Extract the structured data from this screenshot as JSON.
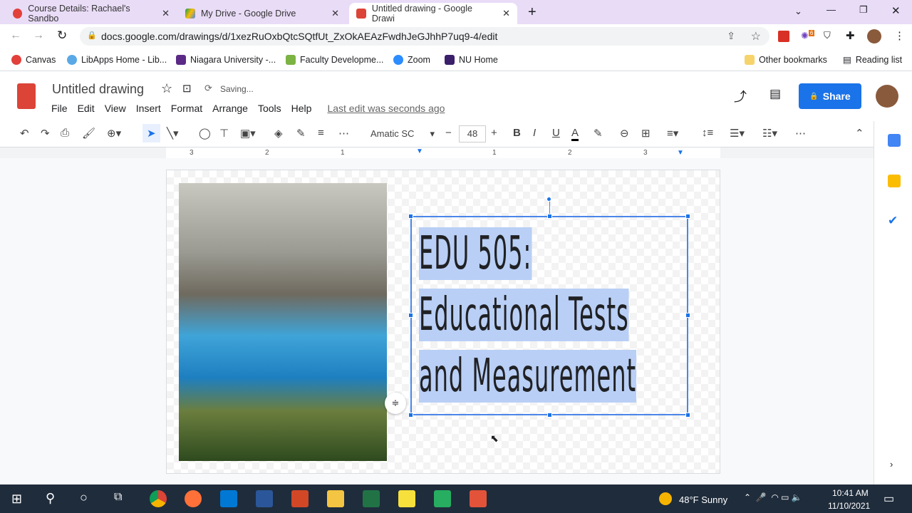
{
  "browser": {
    "tabs": [
      {
        "title": "Course Details: Rachael's Sandbo"
      },
      {
        "title": "My Drive - Google Drive"
      },
      {
        "title": "Untitled drawing - Google Drawi",
        "active": true
      }
    ],
    "url": "docs.google.com/drawings/d/1xezRuOxbQtcSQtfUt_ZxOkAEAzFwdhJeGJhhP7uq9-4/edit",
    "bookmarks": [
      "Canvas",
      "LibApps Home - Lib...",
      "Niagara University -...",
      "Faculty Developme...",
      "Zoom",
      "NU Home"
    ],
    "other_bookmarks": "Other bookmarks",
    "reading_list": "Reading list",
    "ext_badge": "6"
  },
  "doc": {
    "title": "Untitled drawing",
    "status": "Saving...",
    "menu": [
      "File",
      "Edit",
      "View",
      "Insert",
      "Format",
      "Arrange",
      "Tools",
      "Help"
    ],
    "last_edit": "Last edit was seconds ago",
    "share": "Share"
  },
  "toolbar": {
    "font": "Amatic SC",
    "size": "48"
  },
  "ruler": {
    "left": [
      "3",
      "2",
      "1"
    ],
    "right": [
      "1",
      "2",
      "3"
    ]
  },
  "textbox": {
    "lines": [
      "EDU 505:",
      "Educational Tests",
      "and Measurement"
    ]
  },
  "taskbar": {
    "weather": "48°F  Sunny",
    "time": "10:41 AM",
    "date": "11/10/2021"
  },
  "colors": {
    "accent": "#1a73e8",
    "selection": "#b9cff5"
  }
}
